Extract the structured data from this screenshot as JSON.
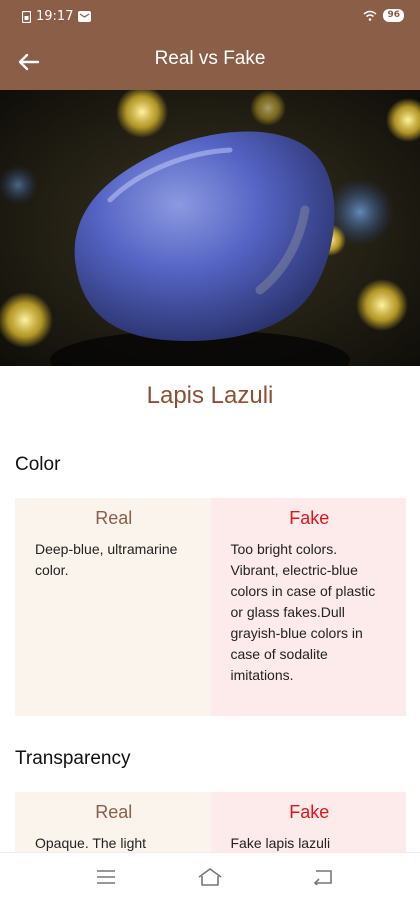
{
  "status": {
    "time": "19:17",
    "battery": "96"
  },
  "header": {
    "title": "Real vs Fake"
  },
  "gem": {
    "name": "Lapis Lazuli"
  },
  "sections": [
    {
      "title": "Color",
      "real_label": "Real",
      "real_text": "Deep-blue, ultramarine color.",
      "fake_label": "Fake",
      "fake_text": "Too bright colors. Vibrant, electric-blue colors in case of plastic or glass fakes.Dull grayish-blue colors in case of sodalite imitations."
    },
    {
      "title": "Transparency",
      "real_label": "Real",
      "real_text": "Opaque. The light",
      "fake_label": "Fake",
      "fake_text": "Fake lapis lazuli"
    }
  ],
  "colors": {
    "brand": "#8b5e48",
    "fake_accent": "#e0151b",
    "real_bg": "#fbf4ec",
    "fake_bg": "#fdeaea"
  }
}
